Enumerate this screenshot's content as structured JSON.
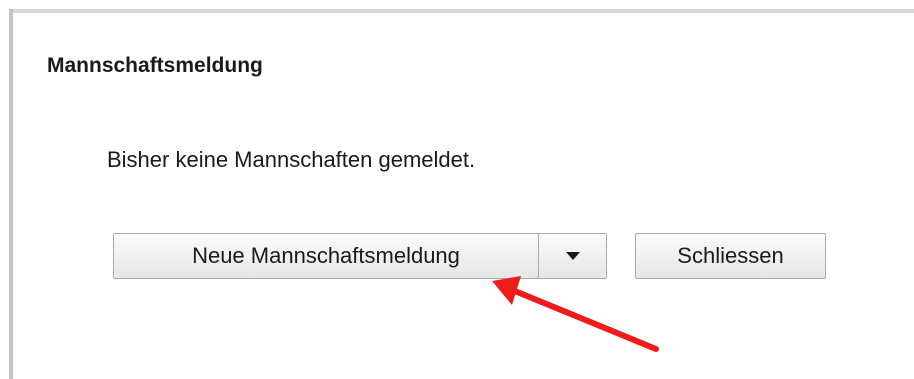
{
  "dialog": {
    "title": "Mannschaftsmeldung",
    "message": "Bisher keine Mannschaften gemeldet.",
    "new_button_label": "Neue Mannschaftsmeldung",
    "dropdown_icon": "chevron-down-icon",
    "close_button_label": "Schliessen"
  },
  "annotation": {
    "icon": "arrow-icon",
    "color": "#ee1c1c"
  }
}
